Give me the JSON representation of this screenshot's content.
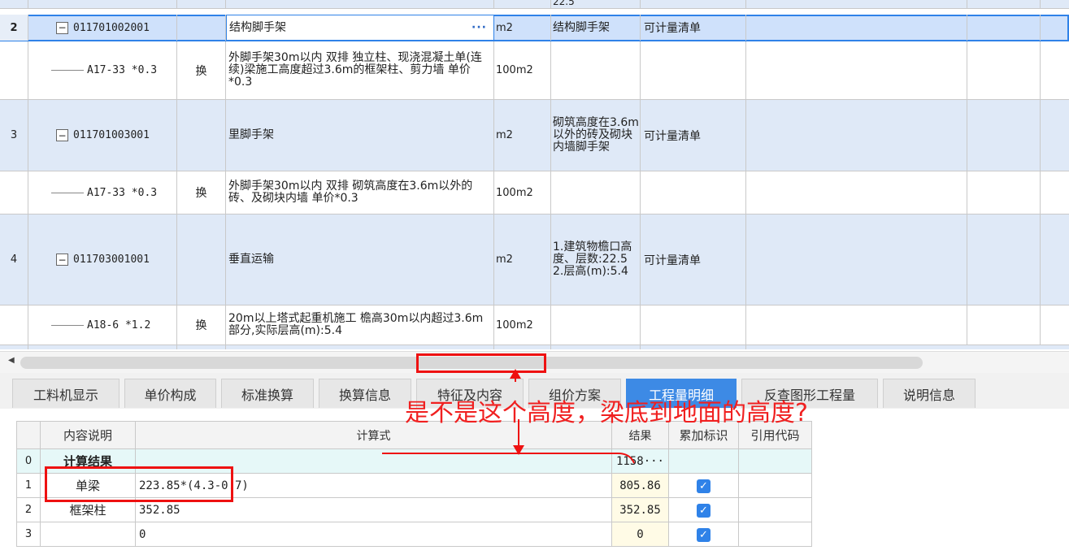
{
  "top_table": {
    "partial_row_feature": "22.5",
    "rows": [
      {
        "index": "2",
        "code": "011701002001",
        "type": "",
        "name": "结构脚手架",
        "unit": "m2",
        "feature": "结构脚手架",
        "category": "可计量清单",
        "selected": true
      },
      {
        "index": "",
        "code": "A17-33 *0.3",
        "type": "换",
        "name": "外脚手架30m以内 双排  独立柱、现浇混凝土单(连续)梁施工高度超过3.6m的框架柱、剪力墙 单价*0.3",
        "unit": "100m2",
        "feature": "",
        "category": ""
      },
      {
        "index": "3",
        "code": "011701003001",
        "type": "",
        "name": "里脚手架",
        "unit": "m2",
        "feature": "砌筑高度在3.6m以外的砖及砌块内墙脚手架",
        "category": "可计量清单"
      },
      {
        "index": "",
        "code": "A17-33 *0.3",
        "type": "换",
        "name": "外脚手架30m以内 双排  砌筑高度在3.6m以外的砖、及砌块内墙 单价*0.3",
        "unit": "100m2",
        "feature": "",
        "category": ""
      },
      {
        "index": "4",
        "code": "011703001001",
        "type": "",
        "name": "垂直运输",
        "unit": "m2",
        "feature": "1.建筑物檐口高度、层数:22.5\n2.层高(m):5.4",
        "category": "可计量清单"
      },
      {
        "index": "",
        "code": "A18-6 *1.2",
        "type": "换",
        "name": "20m以上塔式起重机施工 檐高30m以内超过3.6m部分,实际层高(m):5.4",
        "unit": "100m2",
        "feature": "",
        "category": ""
      }
    ]
  },
  "tabs": [
    {
      "label": "工料机显示"
    },
    {
      "label": "单价构成"
    },
    {
      "label": "标准换算"
    },
    {
      "label": "换算信息"
    },
    {
      "label": "特征及内容"
    },
    {
      "label": "组价方案"
    },
    {
      "label": "工程量明细",
      "active": true
    },
    {
      "label": "反查图形工程量"
    },
    {
      "label": "说明信息"
    }
  ],
  "detail_table": {
    "headers": {
      "desc": "内容说明",
      "formula": "计算式",
      "result": "结果",
      "flag": "累加标识",
      "ref": "引用代码"
    },
    "rows": [
      {
        "index": "0",
        "desc": "计算结果",
        "formula": "",
        "result": "1158···",
        "checked": false
      },
      {
        "index": "1",
        "desc": "单梁",
        "formula": "223.85*(4.3-0.7)",
        "result": "805.86",
        "checked": true
      },
      {
        "index": "2",
        "desc": "框架柱",
        "formula": "352.85",
        "result": "352.85",
        "checked": true
      },
      {
        "index": "3",
        "desc": "",
        "formula": "0",
        "result": "0",
        "checked": true
      }
    ]
  },
  "annotation": {
    "text": "是不是这个高度，梁底到地面的高度?",
    "color": "#ee1111"
  },
  "colors": {
    "accent": "#3d8ae5",
    "selected_border": "#2f82e8"
  },
  "icons": {
    "collapse": "minus-box-icon",
    "scroll_left": "scroll-left-arrow-icon",
    "check": "checkbox-checked-icon"
  }
}
